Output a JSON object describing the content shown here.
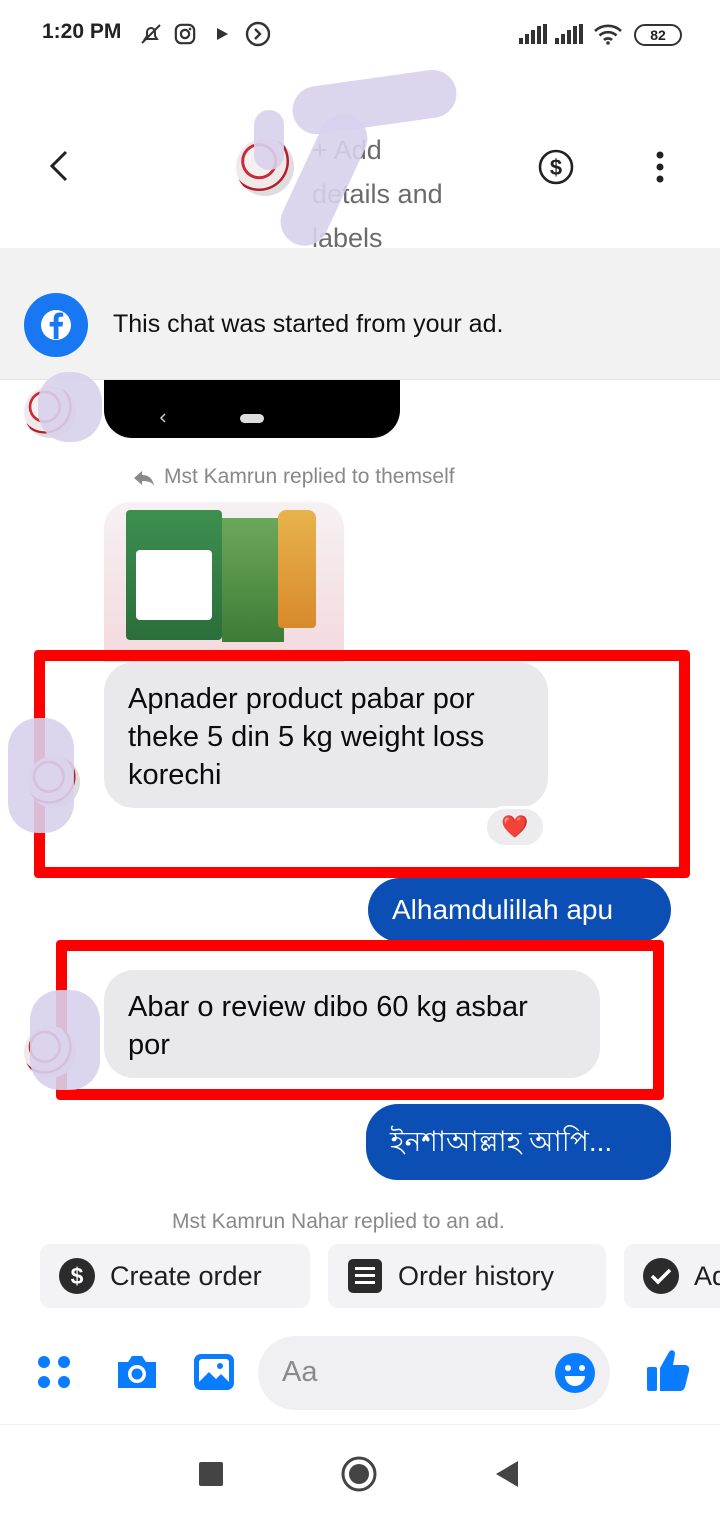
{
  "status_bar": {
    "time": "1:20 PM",
    "battery": "82",
    "icons": [
      "mute-icon",
      "instagram-icon",
      "play-icon",
      "shazam-icon",
      "signal-icon",
      "signal-icon",
      "wifi-icon",
      "battery-icon"
    ]
  },
  "header": {
    "back_icon": "back-arrow-icon",
    "contact_name": "+ Add\ndetails and\nlabels",
    "payment_icon": "dollar-circle-icon",
    "menu_icon": "more-vertical-icon"
  },
  "ad_banner": {
    "text": "This chat was started from your ad.",
    "icon": "facebook-icon"
  },
  "messages": {
    "reply_notice": "Mst Kamrun replied to themself",
    "incoming_1": "Apnader product pabar por theke 5 din 5 kg weight loss korechi",
    "reaction_1": "❤️",
    "outgoing_1": "Alhamdulillah apu",
    "incoming_2": "Abar o review dibo 60 kg asbar por",
    "outgoing_2": "ইনশাআল্লাহ আপি...",
    "system_notice": "Mst Kamrun Nahar replied to an ad."
  },
  "quick_actions": {
    "create_order": "Create order",
    "order_history": "Order history",
    "third": "Ad"
  },
  "composer": {
    "placeholder": "Aa",
    "icons": [
      "apps-icon",
      "camera-icon",
      "gallery-icon",
      "emoji-icon",
      "like-icon"
    ]
  },
  "colors": {
    "accent": "#0b4fb5",
    "facebook_blue": "#1877f2",
    "highlight_red": "#ff0000",
    "incoming_bubble": "#e9e9eb"
  }
}
